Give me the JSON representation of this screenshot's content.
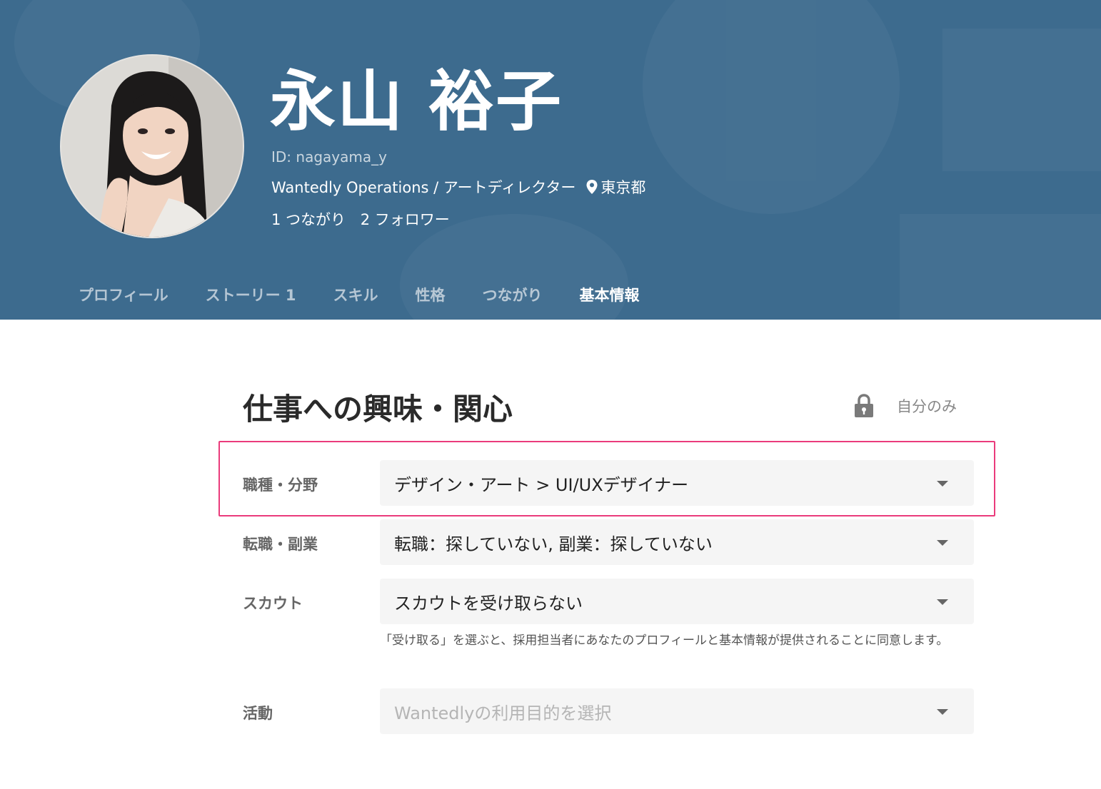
{
  "profile": {
    "name": "永山 裕子",
    "id_text": "ID: nagayama_y",
    "job": "Wantedly Operations / アートディレクター",
    "location": "東京都",
    "connections": "1 つながり",
    "followers": "2 フォロワー"
  },
  "tabs": [
    {
      "label": "プロフィール",
      "active": false
    },
    {
      "label": "ストーリー 1",
      "active": false
    },
    {
      "label": "スキル",
      "active": false
    },
    {
      "label": "性格",
      "active": false
    },
    {
      "label": "つながり",
      "active": false
    },
    {
      "label": "基本情報",
      "active": true
    }
  ],
  "section": {
    "title": "仕事への興味・関心",
    "privacy_label": "自分のみ"
  },
  "fields": [
    {
      "label": "職種・分野",
      "value": "デザイン・アート > UI/UXデザイナー"
    },
    {
      "label": "転職・副業",
      "value": "転職：探していない,  副業：探していない"
    },
    {
      "label": "スカウト",
      "value": "スカウトを受け取らない"
    },
    {
      "label": "活動",
      "placeholder": "Wantedlyの利用目的を選択"
    }
  ],
  "scout_note": "「受け取る」を選ぶと、採用担当者にあなたのプロフィールと基本情報が提供されることに同意します。",
  "colors": {
    "header_bg": "#3d6b8e",
    "tab_indicator": "#21bddb",
    "highlight_border": "#ea3b7b"
  },
  "icons": {
    "location": "map-pin-icon",
    "privacy": "lock-icon",
    "dropdown": "chevron-down-icon"
  }
}
